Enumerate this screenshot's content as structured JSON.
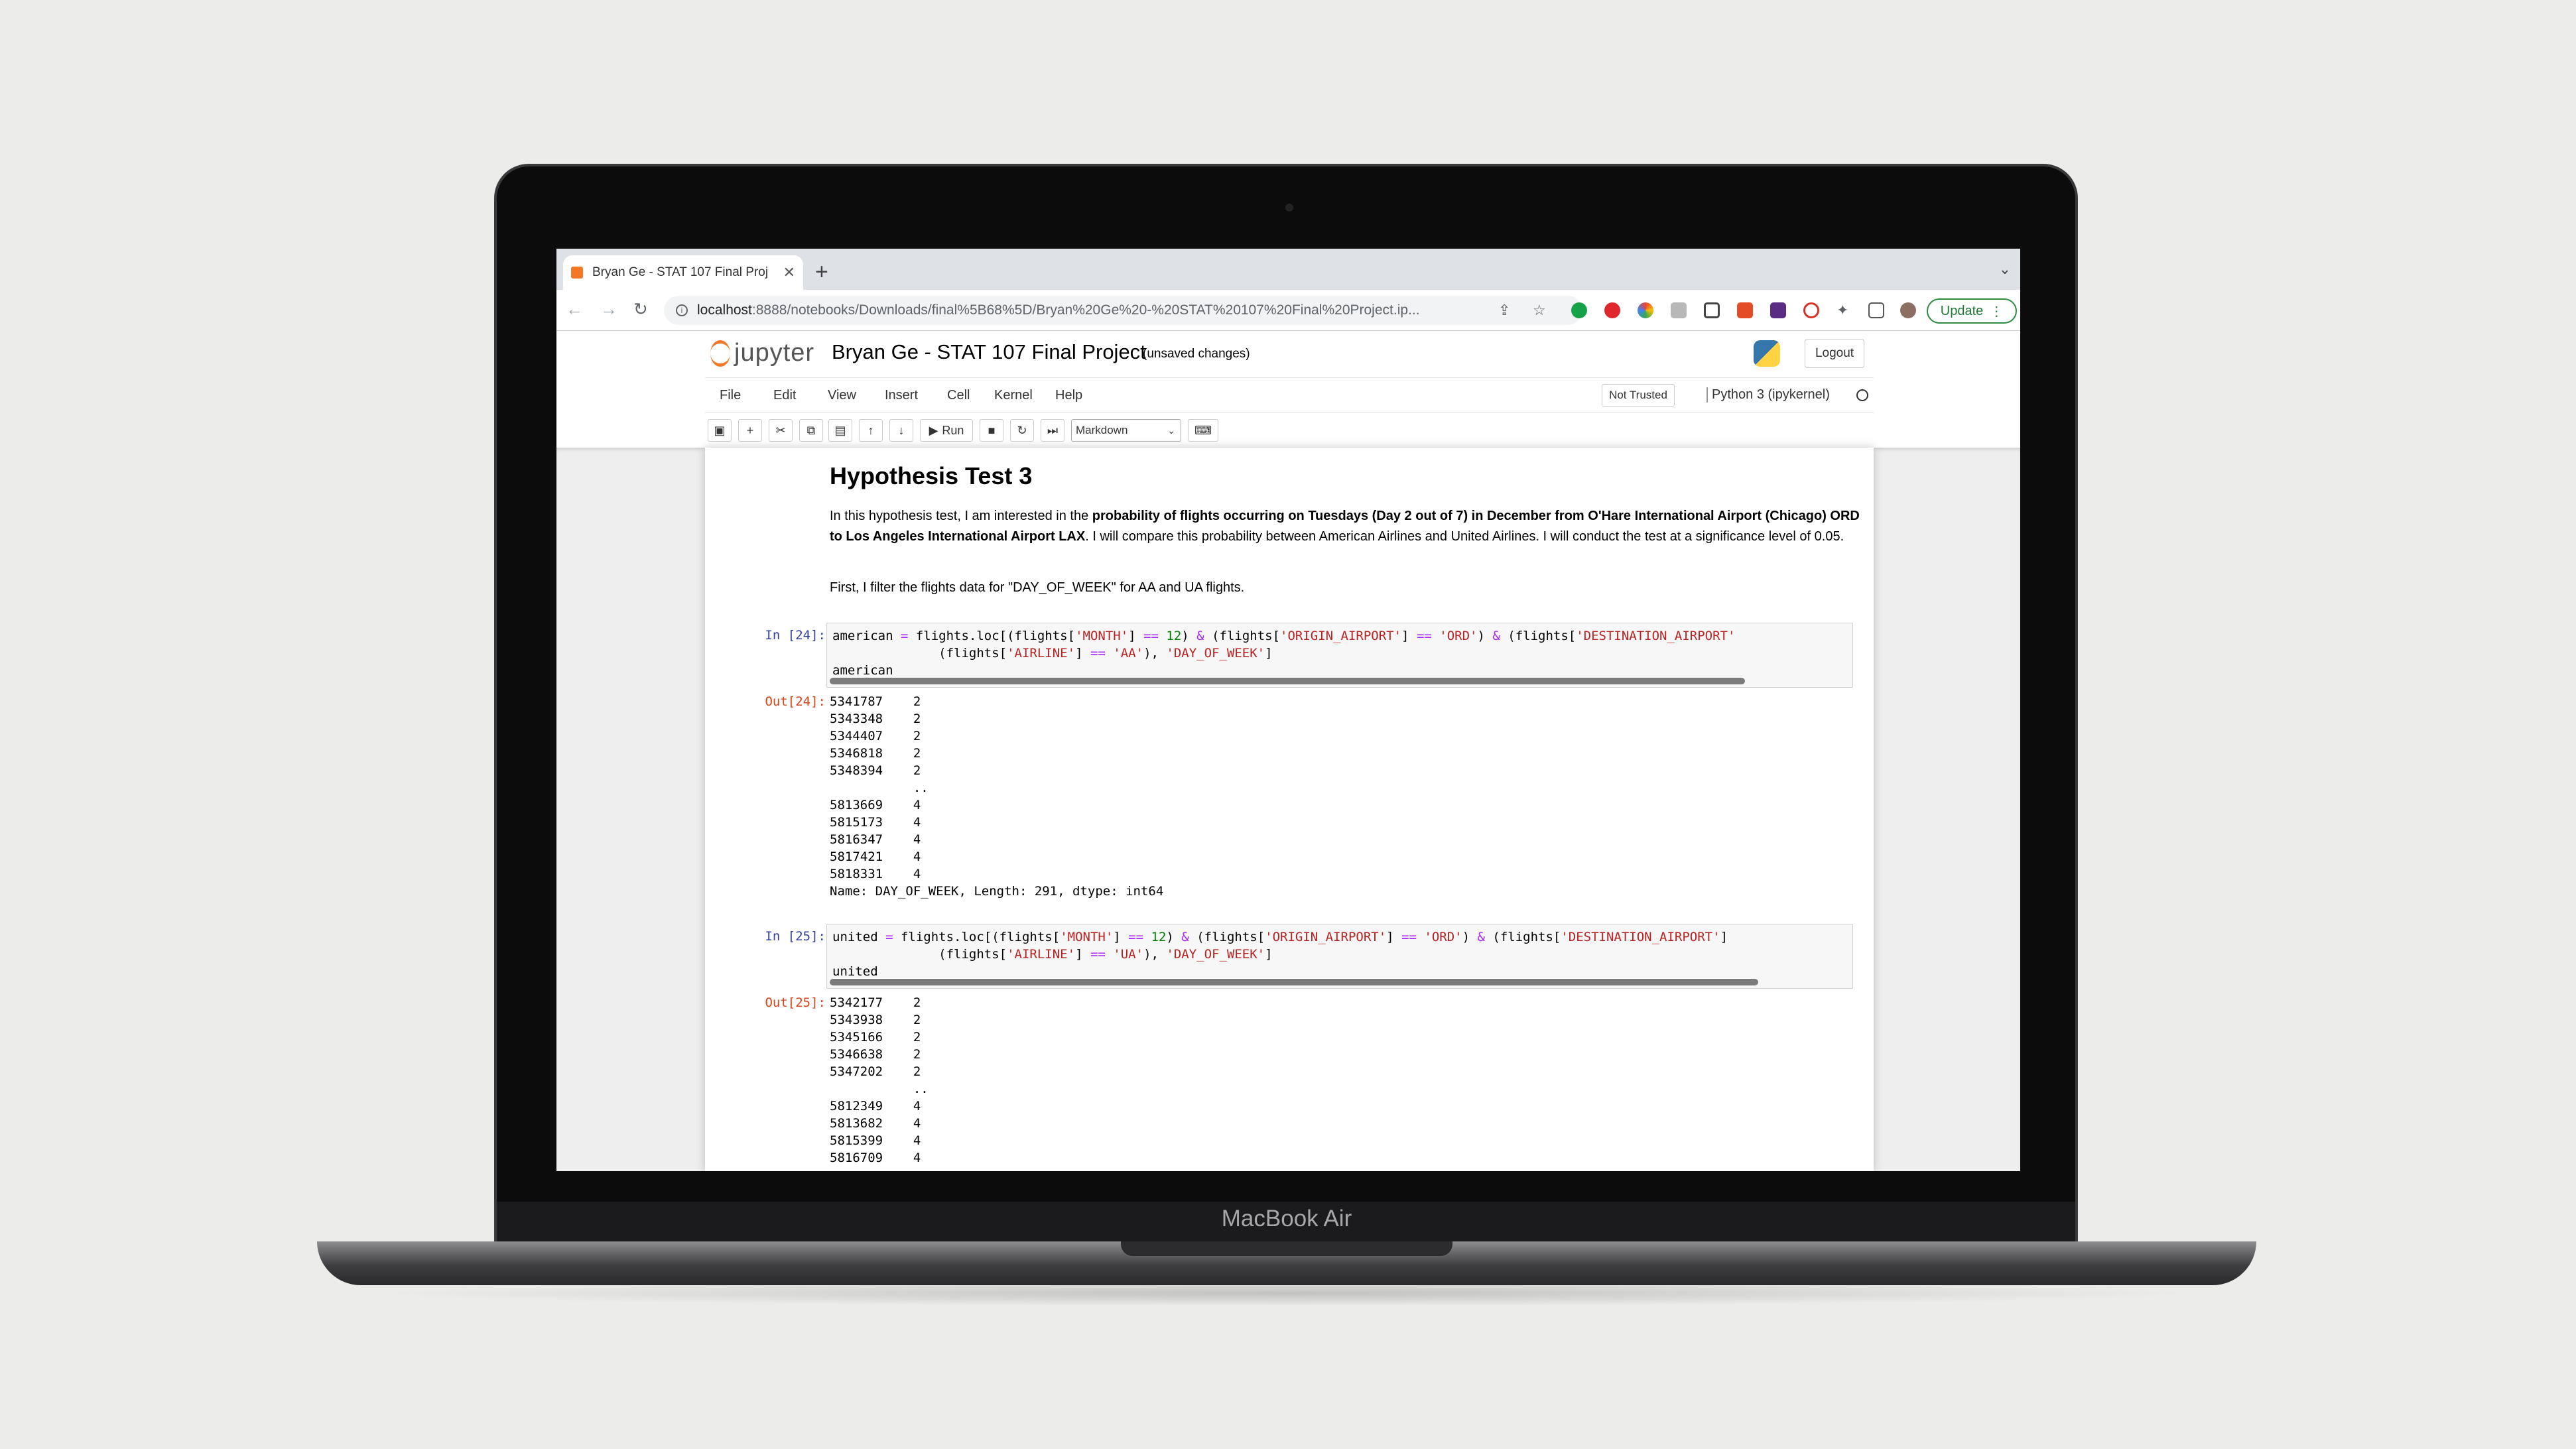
{
  "browser": {
    "tab_title": "Bryan Ge - STAT 107 Final Proj",
    "new_tab": "+",
    "url_host": "localhost",
    "url_rest": ":8888/notebooks/Downloads/final%5B68%5D/Bryan%20Ge%20-%20STAT%20107%20Final%20Project.ip...",
    "update_label": "Update"
  },
  "jupyter": {
    "logo_text": "jupyter",
    "notebook_title": "Bryan Ge - STAT 107 Final Project",
    "save_status": "(unsaved changes)",
    "logout_label": "Logout",
    "menu": [
      "File",
      "Edit",
      "View",
      "Insert",
      "Cell",
      "Kernel",
      "Help"
    ],
    "trust_label": "Not Trusted",
    "kernel_label": "Python 3 (ipykernel)",
    "run_label": "Run",
    "cell_type": "Markdown"
  },
  "notebook": {
    "heading": "Hypothesis Test 3",
    "para1_a": "In this hypothesis test, I am interested in the ",
    "para1_b": "probability of flights occurring on Tuesdays (Day 2 out of 7) in December from O'Hare International Airport (Chicago) ORD to Los Angeles International Airport LAX",
    "para1_c": ". I will compare this probability between American Airlines and United Airlines. I will conduct the test at a significance level of 0.05.",
    "para2": "First, I filter the flights data for \"DAY_OF_WEEK\" for AA and UA flights.",
    "in24": "In [24]:",
    "out24": "Out[24]:",
    "in25": "In [25]:",
    "out25": "Out[25]:",
    "cell24_last": "american",
    "cell25_last": "united",
    "out24_rows": [
      "5341787    2",
      "5343348    2",
      "5344407    2",
      "5346818    2",
      "5348394    2",
      "           ..",
      "5813669    4",
      "5815173    4",
      "5816347    4",
      "5817421    4",
      "5818331    4",
      "Name: DAY_OF_WEEK, Length: 291, dtype: int64"
    ],
    "out25_rows": [
      "5342177    2",
      "5343938    2",
      "5345166    2",
      "5346638    2",
      "5347202    2",
      "           ..",
      "5812349    4",
      "5813682    4",
      "5815399    4",
      "5816709    4"
    ]
  },
  "device": {
    "label": "MacBook Air"
  }
}
